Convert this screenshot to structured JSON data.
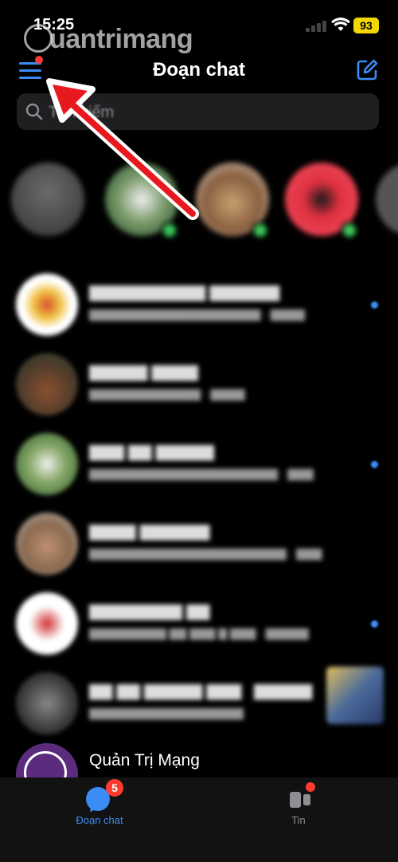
{
  "status_bar": {
    "time": "15:25",
    "battery": "93"
  },
  "watermark": {
    "text": "uantrimang"
  },
  "header": {
    "title": "Đoạn chat"
  },
  "search": {
    "placeholder": "Tìm kiếm"
  },
  "colors": {
    "accent": "#3b8cf5",
    "badge": "#ff3b30",
    "online": "#3ccb5c",
    "arrow": "#e8191e"
  },
  "chats_visible": {
    "last_name": "Quản Trị Mạng"
  },
  "tab_bar": {
    "chats": {
      "label": "Đoạn chat",
      "badge": "5"
    },
    "stories": {
      "label": "Tin"
    }
  }
}
